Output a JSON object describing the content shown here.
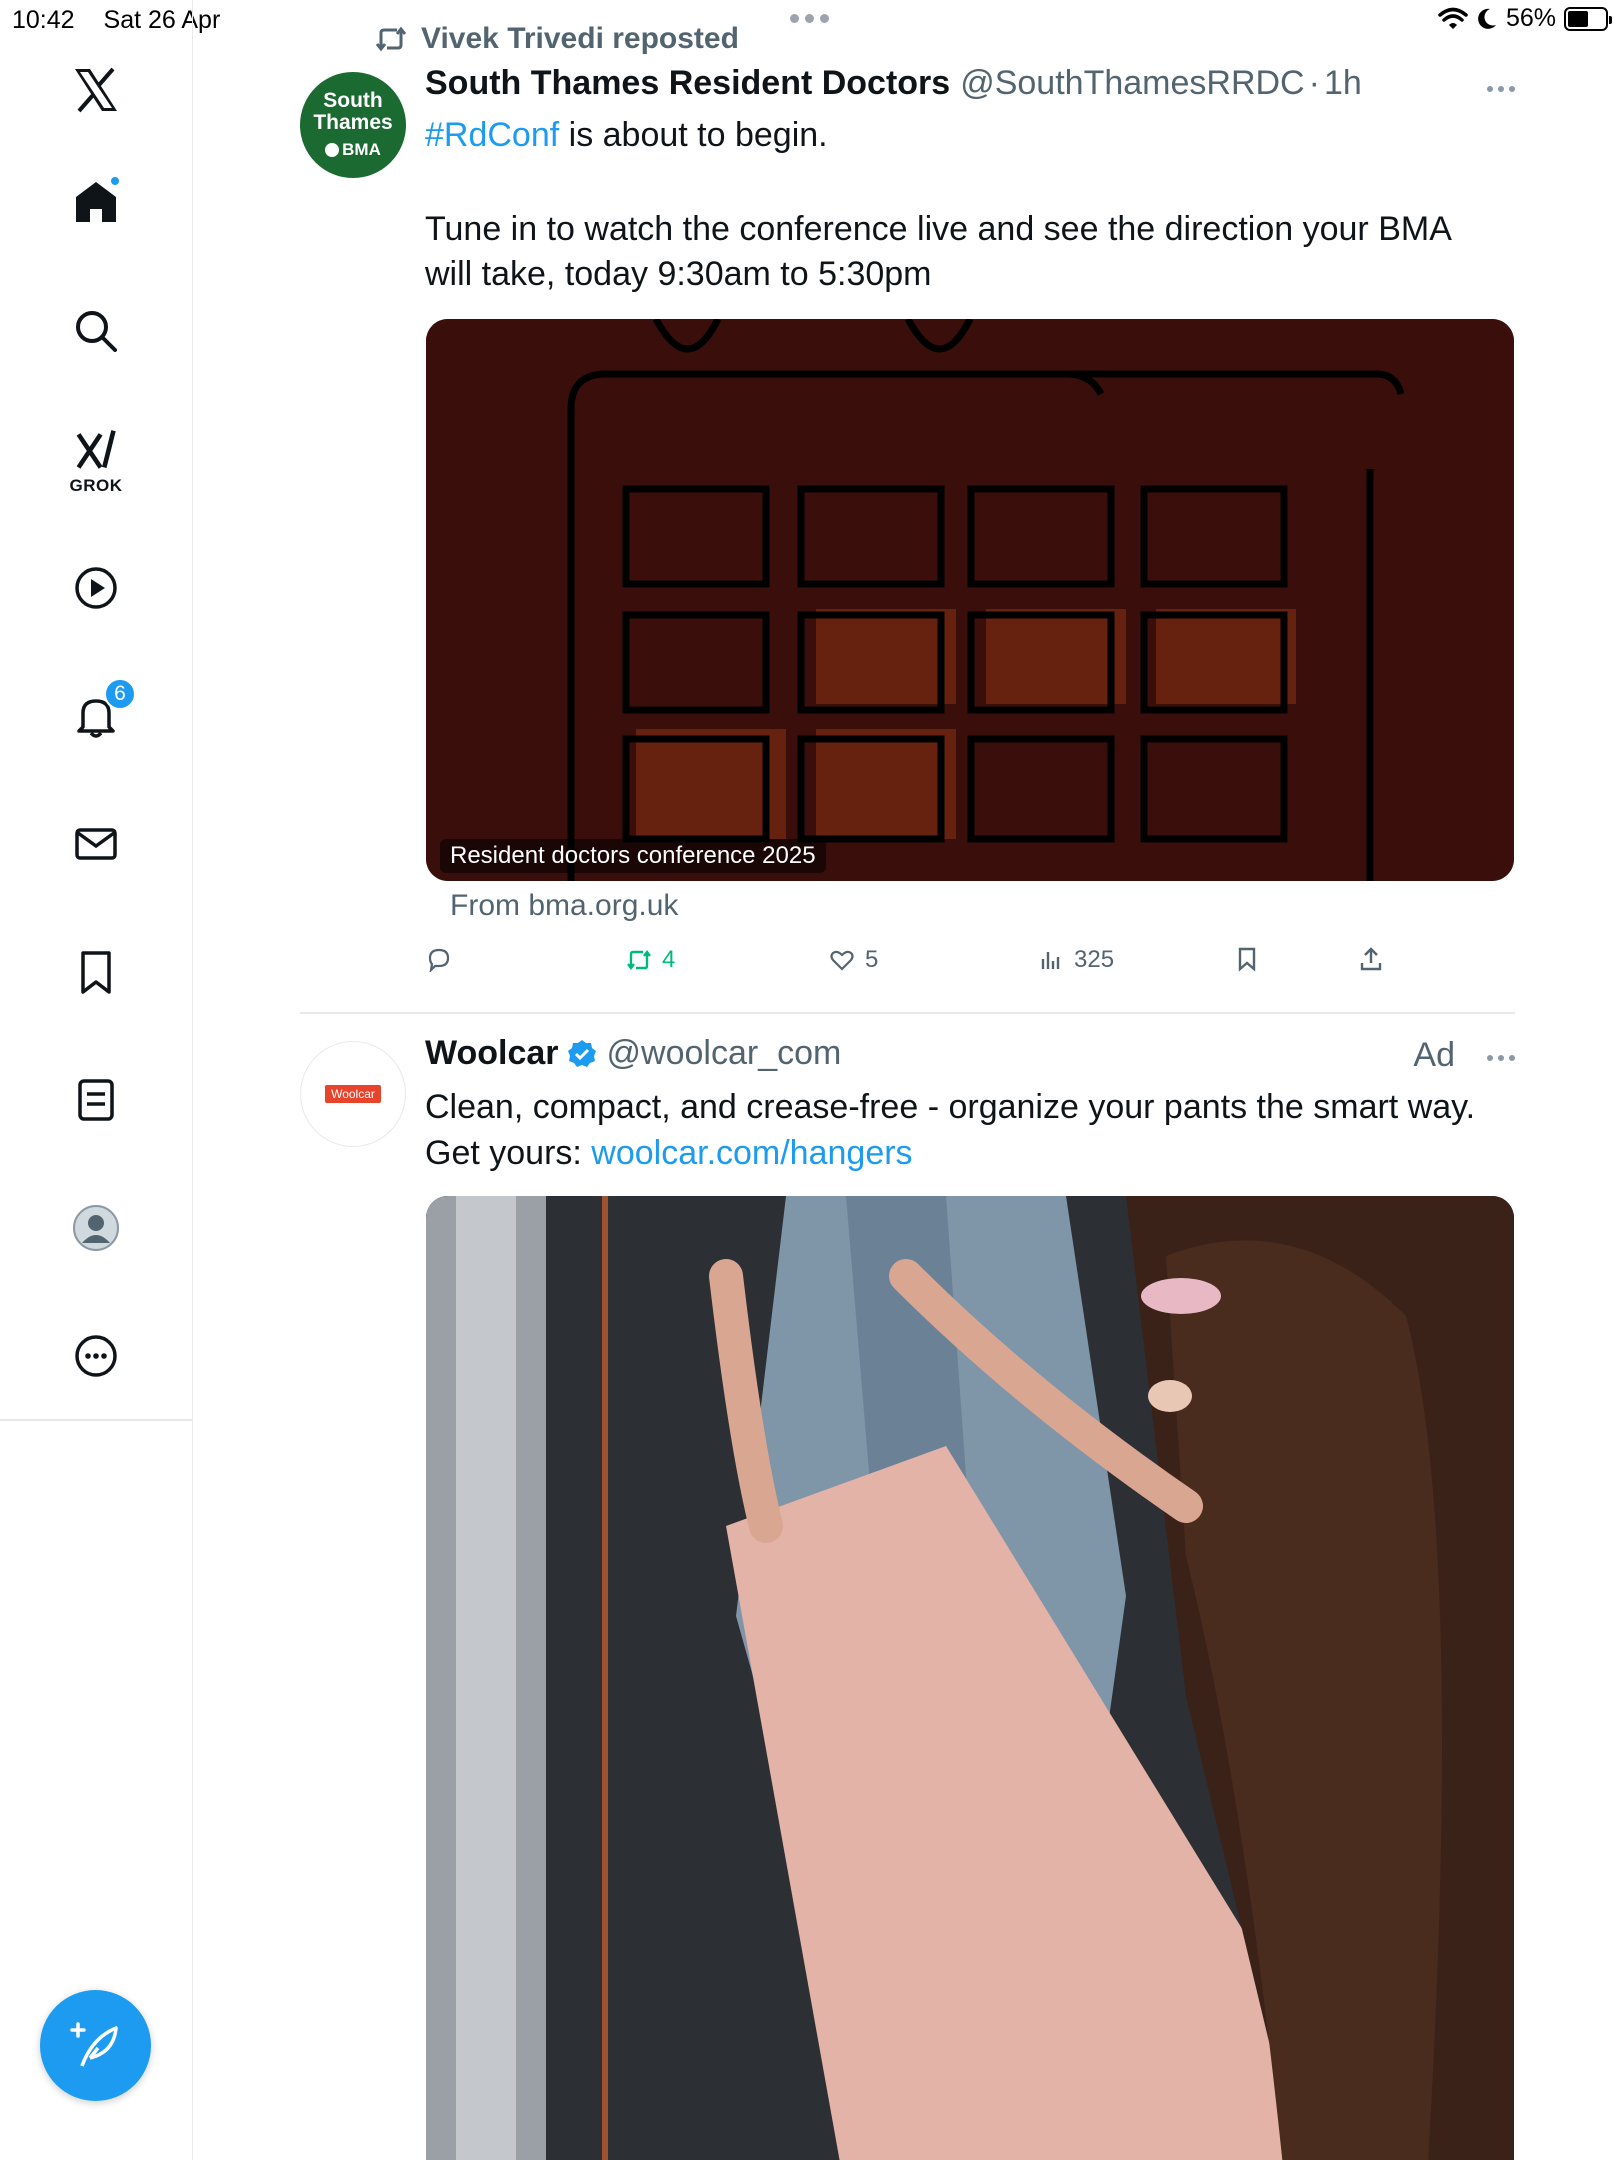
{
  "status_bar": {
    "time": "10:42",
    "date": "Sat 26 Apr",
    "battery_percent": "56%",
    "battery_level": 0.56
  },
  "sidebar": {
    "items": [
      {
        "name": "x-logo",
        "label": ""
      },
      {
        "name": "home",
        "label": ""
      },
      {
        "name": "search",
        "label": ""
      },
      {
        "name": "grok",
        "label": "GROK"
      },
      {
        "name": "video",
        "label": ""
      },
      {
        "name": "notifications",
        "label": "",
        "badge": "6"
      },
      {
        "name": "messages",
        "label": ""
      },
      {
        "name": "bookmarks",
        "label": ""
      },
      {
        "name": "lists",
        "label": ""
      },
      {
        "name": "profile",
        "label": ""
      },
      {
        "name": "more",
        "label": ""
      }
    ],
    "notifications_badge": "6"
  },
  "feed": {
    "tweet1": {
      "repost_label": "Vivek Trivedi reposted",
      "avatar_text": [
        "South",
        "Thames",
        "BMA"
      ],
      "display_name": "South Thames Resident Doctors",
      "handle": "@SouthThamesRRDC",
      "separator": "·",
      "time": "1h",
      "hashtag": "#RdConf",
      "text_line1_rest": " is about to begin.",
      "text_para2": "Tune in to watch the conference live and see the direction your BMA will take, today 9:30am to 5:30pm",
      "media_caption": "Resident doctors conference 2025",
      "link_source": "From bma.org.uk",
      "stats": {
        "replies": "",
        "reposts": "4",
        "likes": "5",
        "views": "325"
      }
    },
    "tweet2": {
      "avatar_text": "Woolcar",
      "display_name": "Woolcar",
      "handle": "@woolcar_com",
      "ad_label": "Ad",
      "text_line1": "Clean, compact, and crease-free - organize your pants the smart way.",
      "text_prefix": "Get yours: ",
      "link": "woolcar.com/hangers"
    }
  },
  "colors": {
    "accent": "#1d9bf0",
    "repost_green": "#00ba7c",
    "muted": "#536471",
    "media_bg": "#3a0f0b",
    "avatar_green": "#1b6a32"
  }
}
